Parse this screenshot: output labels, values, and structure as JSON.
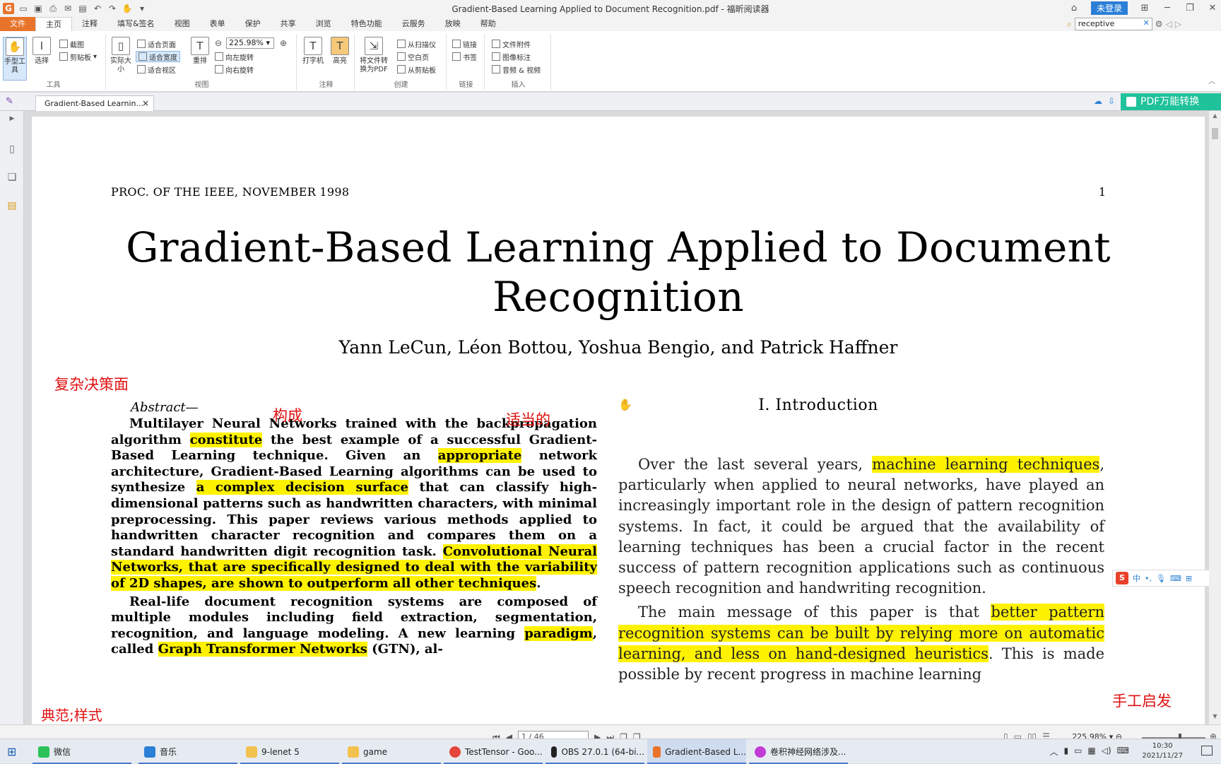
{
  "window": {
    "title": "Gradient-Based Learning Applied to Document Recognition.pdf - 福昕阅读器",
    "login_label": "未登录"
  },
  "menu": {
    "file": "文件",
    "tabs": [
      "主页",
      "注释",
      "填写&签名",
      "视图",
      "表单",
      "保护",
      "共享",
      "浏览",
      "特色功能",
      "云服务",
      "放映",
      "帮助"
    ],
    "search_value": "receptive"
  },
  "ribbon": {
    "tools_group": "工具",
    "hand_tool": "手型工具",
    "select_tool": "选择",
    "snapshot": "截图",
    "clipboard": "剪贴板",
    "actual_size": "实际大小",
    "fit_page": "适合页面",
    "fit_width": "适合宽度",
    "fit_visible": "适合视区",
    "reflow": "重排",
    "zoom_value": "225.98%",
    "rotate_left": "向左旋转",
    "rotate_right": "向右旋转",
    "view_group": "视图",
    "typewriter": "打字机",
    "highlight": "高亮",
    "comment_group": "注释",
    "convert_pdf": "将文件转换为PDF",
    "from_scanner": "从扫描仪",
    "blank_page": "空白页",
    "from_clipboard": "从剪贴板",
    "create_group": "创建",
    "link": "链接",
    "bookmark": "书签",
    "link_group": "链接",
    "file_attachment": "文件附件",
    "image_annotation": "图像标注",
    "audio_video": "音频 & 视频",
    "insert_group": "插入"
  },
  "tabbar": {
    "doc_tab": "Gradient-Based Learnin...",
    "pdf_convert": "PDF万能转换"
  },
  "page": {
    "running_head": "PROC. OF THE IEEE, NOVEMBER 1998",
    "page_number": "1",
    "title_line1": "Gradient-Based Learning Applied to Document",
    "title_line2": "Recognition",
    "authors": "Yann LeCun, Léon Bottou, Yoshua Bengio, and Patrick Haffner",
    "abstract_label": "Abstract—",
    "abs1_a": "Multilayer Neural Networks trained with the backpropagation algorithm ",
    "abs1_h1": "constitute",
    "abs1_b": " the best example of a successful Gradient-Based Learning technique. Given an ",
    "abs1_h2": "appropriate",
    "abs1_c": " network architecture, Gradient-Based Learning algorithms can be used to synthesize ",
    "abs1_h3": "a complex decision surface",
    "abs1_d": " that can classify high-dimensional patterns such as handwritten characters, with minimal preprocessing. This paper reviews various methods applied to handwritten character recognition and compares them on a standard handwritten digit recognition task. ",
    "abs1_h4": "Convolutional Neural Networks, that are specifically designed to deal with the variability of 2D shapes, are shown to outperform all other techniques",
    "abs1_e": ".",
    "abs2_a": "Real-life document recognition systems are composed of multiple modules including field extraction, segmentation, recognition, and language modeling. A new learning ",
    "abs2_h1": "paradigm",
    "abs2_b": ", called ",
    "abs2_h2": "Graph Transformer Networks",
    "abs2_c": " (GTN), al-",
    "intro_heading": "I. Introduction",
    "intro1_a": "Over the last several years, ",
    "intro1_h1": "machine learning techniques",
    "intro1_b": ", particularly when applied to neural networks, have played an increasingly important role in the design of pattern recognition systems. In fact, it could be argued that the availability of learning techniques has been a crucial factor in the recent success of pattern recognition applications such as continuous speech recognition and handwriting recognition.",
    "intro2_a": "The main message of this paper is that ",
    "intro2_h1": "better pattern recognition systems can be built by relying more on automatic learning, and less on hand-designed heuristics",
    "intro2_b": ". This is made possible by recent progress in machine learning"
  },
  "notes": {
    "n1": "复杂决策面",
    "n2": "构成",
    "n3": "适当的",
    "n4": "手工启发",
    "n5": "典范;样式"
  },
  "ime": {
    "label": "中"
  },
  "statusbar": {
    "page_indicator": "1 / 46",
    "zoom": "225.98%"
  },
  "taskbar": {
    "items": [
      "微信",
      "音乐",
      "9-lenet 5",
      "game",
      "TestTensor - Goo...",
      "OBS 27.0.1 (64-bi...",
      "Gradient-Based L...",
      "卷积神经网络涉及..."
    ],
    "time": "10:30",
    "date": "2021/11/27"
  },
  "colors": {
    "accent_orange": "#e8742b",
    "highlight": "#fff200",
    "note_red": "#e01010",
    "convert_green": "#1fc29a"
  }
}
